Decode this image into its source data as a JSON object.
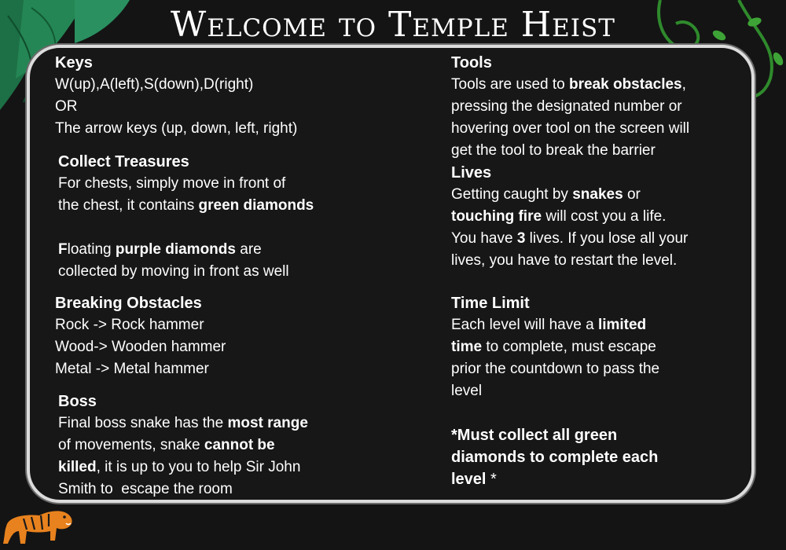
{
  "title": "Welcome to Temple Heist",
  "colors": {
    "background": "#141414",
    "panel_border": "#dcdcdc",
    "text": "#ffffff",
    "leaf_green": "#1f7a4a",
    "vine_green": "#2f8a2c",
    "tiger_orange": "#e8821e"
  },
  "decorations": {
    "top_left": "jungle-leaves-icon",
    "top_right": "hanging-vine-icon",
    "bottom_left": "tiger-icon"
  },
  "keys": {
    "heading": "Keys",
    "line1": "W(up),A(left),S(down),D(right)",
    "line2": "OR",
    "line3": "The arrow keys (up, down, left, right)"
  },
  "treasures": {
    "heading": "Collect Treasures",
    "p1_a": "For chests, simply move in front of",
    "p1_b": "the chest, it contains ",
    "p1_bold": "green diamonds",
    "p2_bold_f": "F",
    "p2_a": "loating ",
    "p2_bold": "purple diamonds",
    "p2_b": " are",
    "p2_c": "collected by moving in front as well"
  },
  "obstacles": {
    "heading": "Breaking Obstacles",
    "line1": "Rock -> Rock hammer",
    "line2": "Wood-> Wooden hammer",
    "line3": "Metal -> Metal hammer"
  },
  "boss": {
    "heading": "Boss",
    "l1_a": "Final boss snake has the ",
    "l1_bold": "most range",
    "l2_a": "of movements, snake ",
    "l2_bold": "cannot be",
    "l3_bold": "killed",
    "l3_a": ", it is up to you to help Sir John",
    "l4": "Smith to  escape the room"
  },
  "tools": {
    "heading": "Tools",
    "l1_a": "Tools are used to ",
    "l1_bold": "break obstacles",
    "l1_b": ",",
    "l2": "pressing the designated number or",
    "l3": "hovering over tool on the screen will",
    "l4": "get the tool to break the barrier"
  },
  "lives": {
    "heading": "Lives",
    "l1_a": "Getting caught by ",
    "l1_bold": "snakes",
    "l1_b": " or",
    "l2_bold": "touching fire",
    "l2_a": " will cost you a life.",
    "l3_a": "You have ",
    "l3_bold": "3",
    "l3_b": " lives. If you lose all your",
    "l4": "lives, you have to restart the level."
  },
  "time_limit": {
    "heading": "Time Limit",
    "l1_a": "Each level will have a ",
    "l1_bold": "limited",
    "l2_bold": "time",
    "l2_a": " to complete, must escape",
    "l3": "prior the countdown to pass the",
    "l4": "level"
  },
  "note": {
    "l1": "*Must collect all green",
    "l2": "diamonds to complete each",
    "l3": "level",
    "l3_plain": " *"
  }
}
